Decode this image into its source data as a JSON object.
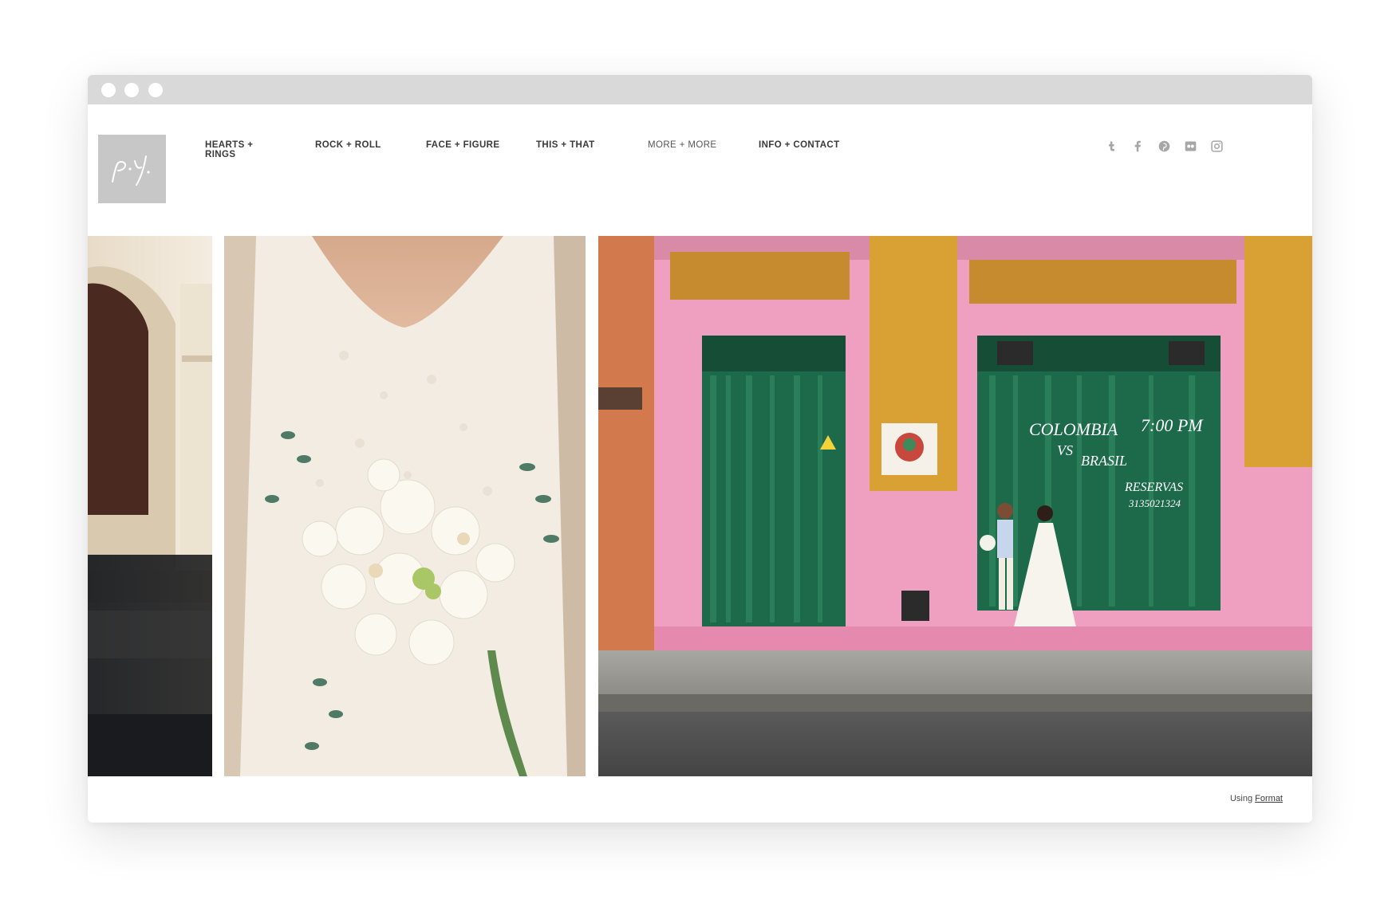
{
  "nav": {
    "items": [
      {
        "label": "HEARTS +\nRINGS"
      },
      {
        "label": "ROCK + ROLL"
      },
      {
        "label": "FACE + FIGURE"
      },
      {
        "label": "THIS + THAT"
      },
      {
        "label": "MORE + MORE"
      },
      {
        "label": "INFO + CONTACT"
      }
    ]
  },
  "social": [
    "tumblr-icon",
    "facebook-icon",
    "pinterest-icon",
    "flickr-icon",
    "instagram-icon"
  ],
  "photo3": {
    "chalk_line1": "COLOMBIA",
    "chalk_line2": "VS",
    "chalk_line3": "BRASIL",
    "chalk_time": "7:00 PM",
    "chalk_reservas": "RESERVAS",
    "chalk_phone": "3135021324"
  },
  "footer": {
    "prefix": "Using",
    "link": "Format"
  },
  "colors": {
    "chrome": "#d9d9d9",
    "logo_bg": "#c7c7c7",
    "nav_text": "#3a3a3a",
    "icon": "#a6a6a6"
  }
}
